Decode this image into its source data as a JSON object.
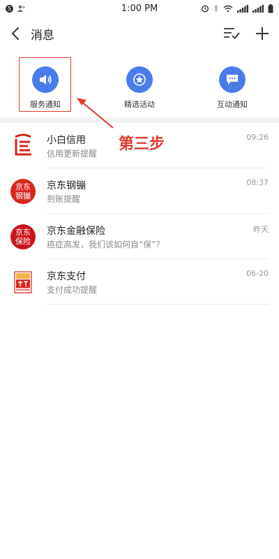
{
  "status_bar": {
    "time": "1:00 PM",
    "left_badge": "5"
  },
  "header": {
    "title": "消息",
    "back_icon": "chevron-left-icon",
    "actions": [
      "mark-all-read-icon",
      "plus-icon"
    ]
  },
  "quick_categories": [
    {
      "label": "服务通知",
      "icon": "speaker-icon"
    },
    {
      "label": "精选活动",
      "icon": "star-badge-icon"
    },
    {
      "label": "互动通知",
      "icon": "chat-bubble-icon"
    }
  ],
  "messages": [
    {
      "title": "小白信用",
      "subtitle": "信用更新提醒",
      "time": "09:26",
      "avatar": "xiaobai-credit-logo"
    },
    {
      "title": "京东钢镚",
      "subtitle": "到账提醒",
      "time": "08:37",
      "avatar_text": [
        "京东",
        "钢镚"
      ]
    },
    {
      "title": "京东金融保险",
      "subtitle": "癌症高发，我们该如何自“保”？",
      "time": "昨天",
      "avatar_text": [
        "京东",
        "保险"
      ]
    },
    {
      "title": "京东支付",
      "subtitle": "支付成功提醒",
      "time": "06-20",
      "avatar": "jd-pay-logo"
    }
  ],
  "annotation": {
    "text": "第三步",
    "color": "#e03a2e"
  },
  "colors": {
    "accent": "#4a7ce8",
    "brand_red": "#d8261d"
  }
}
